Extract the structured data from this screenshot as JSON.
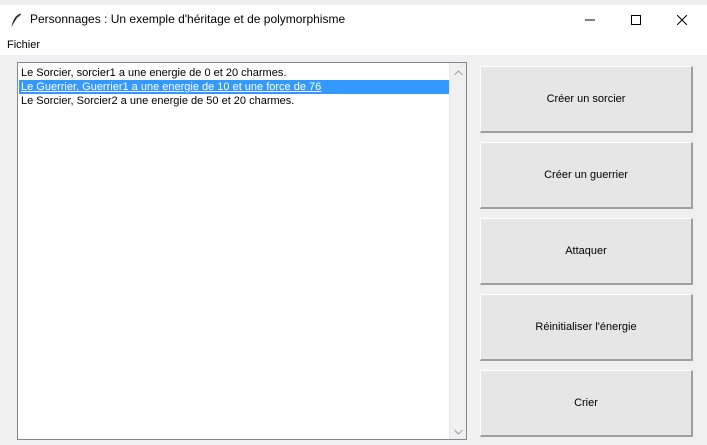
{
  "window": {
    "title": "Personnages : Un exemple d'héritage et de polymorphisme",
    "app_icon": "feather-icon",
    "controls": [
      "minimize-icon",
      "maximize-icon",
      "close-icon"
    ]
  },
  "menu": {
    "items": [
      {
        "label": "Fichier"
      }
    ]
  },
  "listbox": {
    "items": [
      {
        "text": "Le Sorcier, sorcier1 a une energie de 0 et 20 charmes.",
        "selected": false
      },
      {
        "text": "Le Guerrier, Guerrier1 a une energie de 10 et une force de 76",
        "selected": true
      },
      {
        "text": "Le Sorcier, Sorcier2 a une energie de 50 et 20 charmes.",
        "selected": false
      }
    ]
  },
  "buttons": [
    {
      "label": "Créer un sorcier"
    },
    {
      "label": "Créer un guerrier"
    },
    {
      "label": "Attaquer"
    },
    {
      "label": "Réinitialiser l'énergie"
    },
    {
      "label": "Crier"
    }
  ],
  "colors": {
    "selection": "#3399ff",
    "window_bg": "#f0f0f0",
    "button_face": "#e6e6e6"
  }
}
